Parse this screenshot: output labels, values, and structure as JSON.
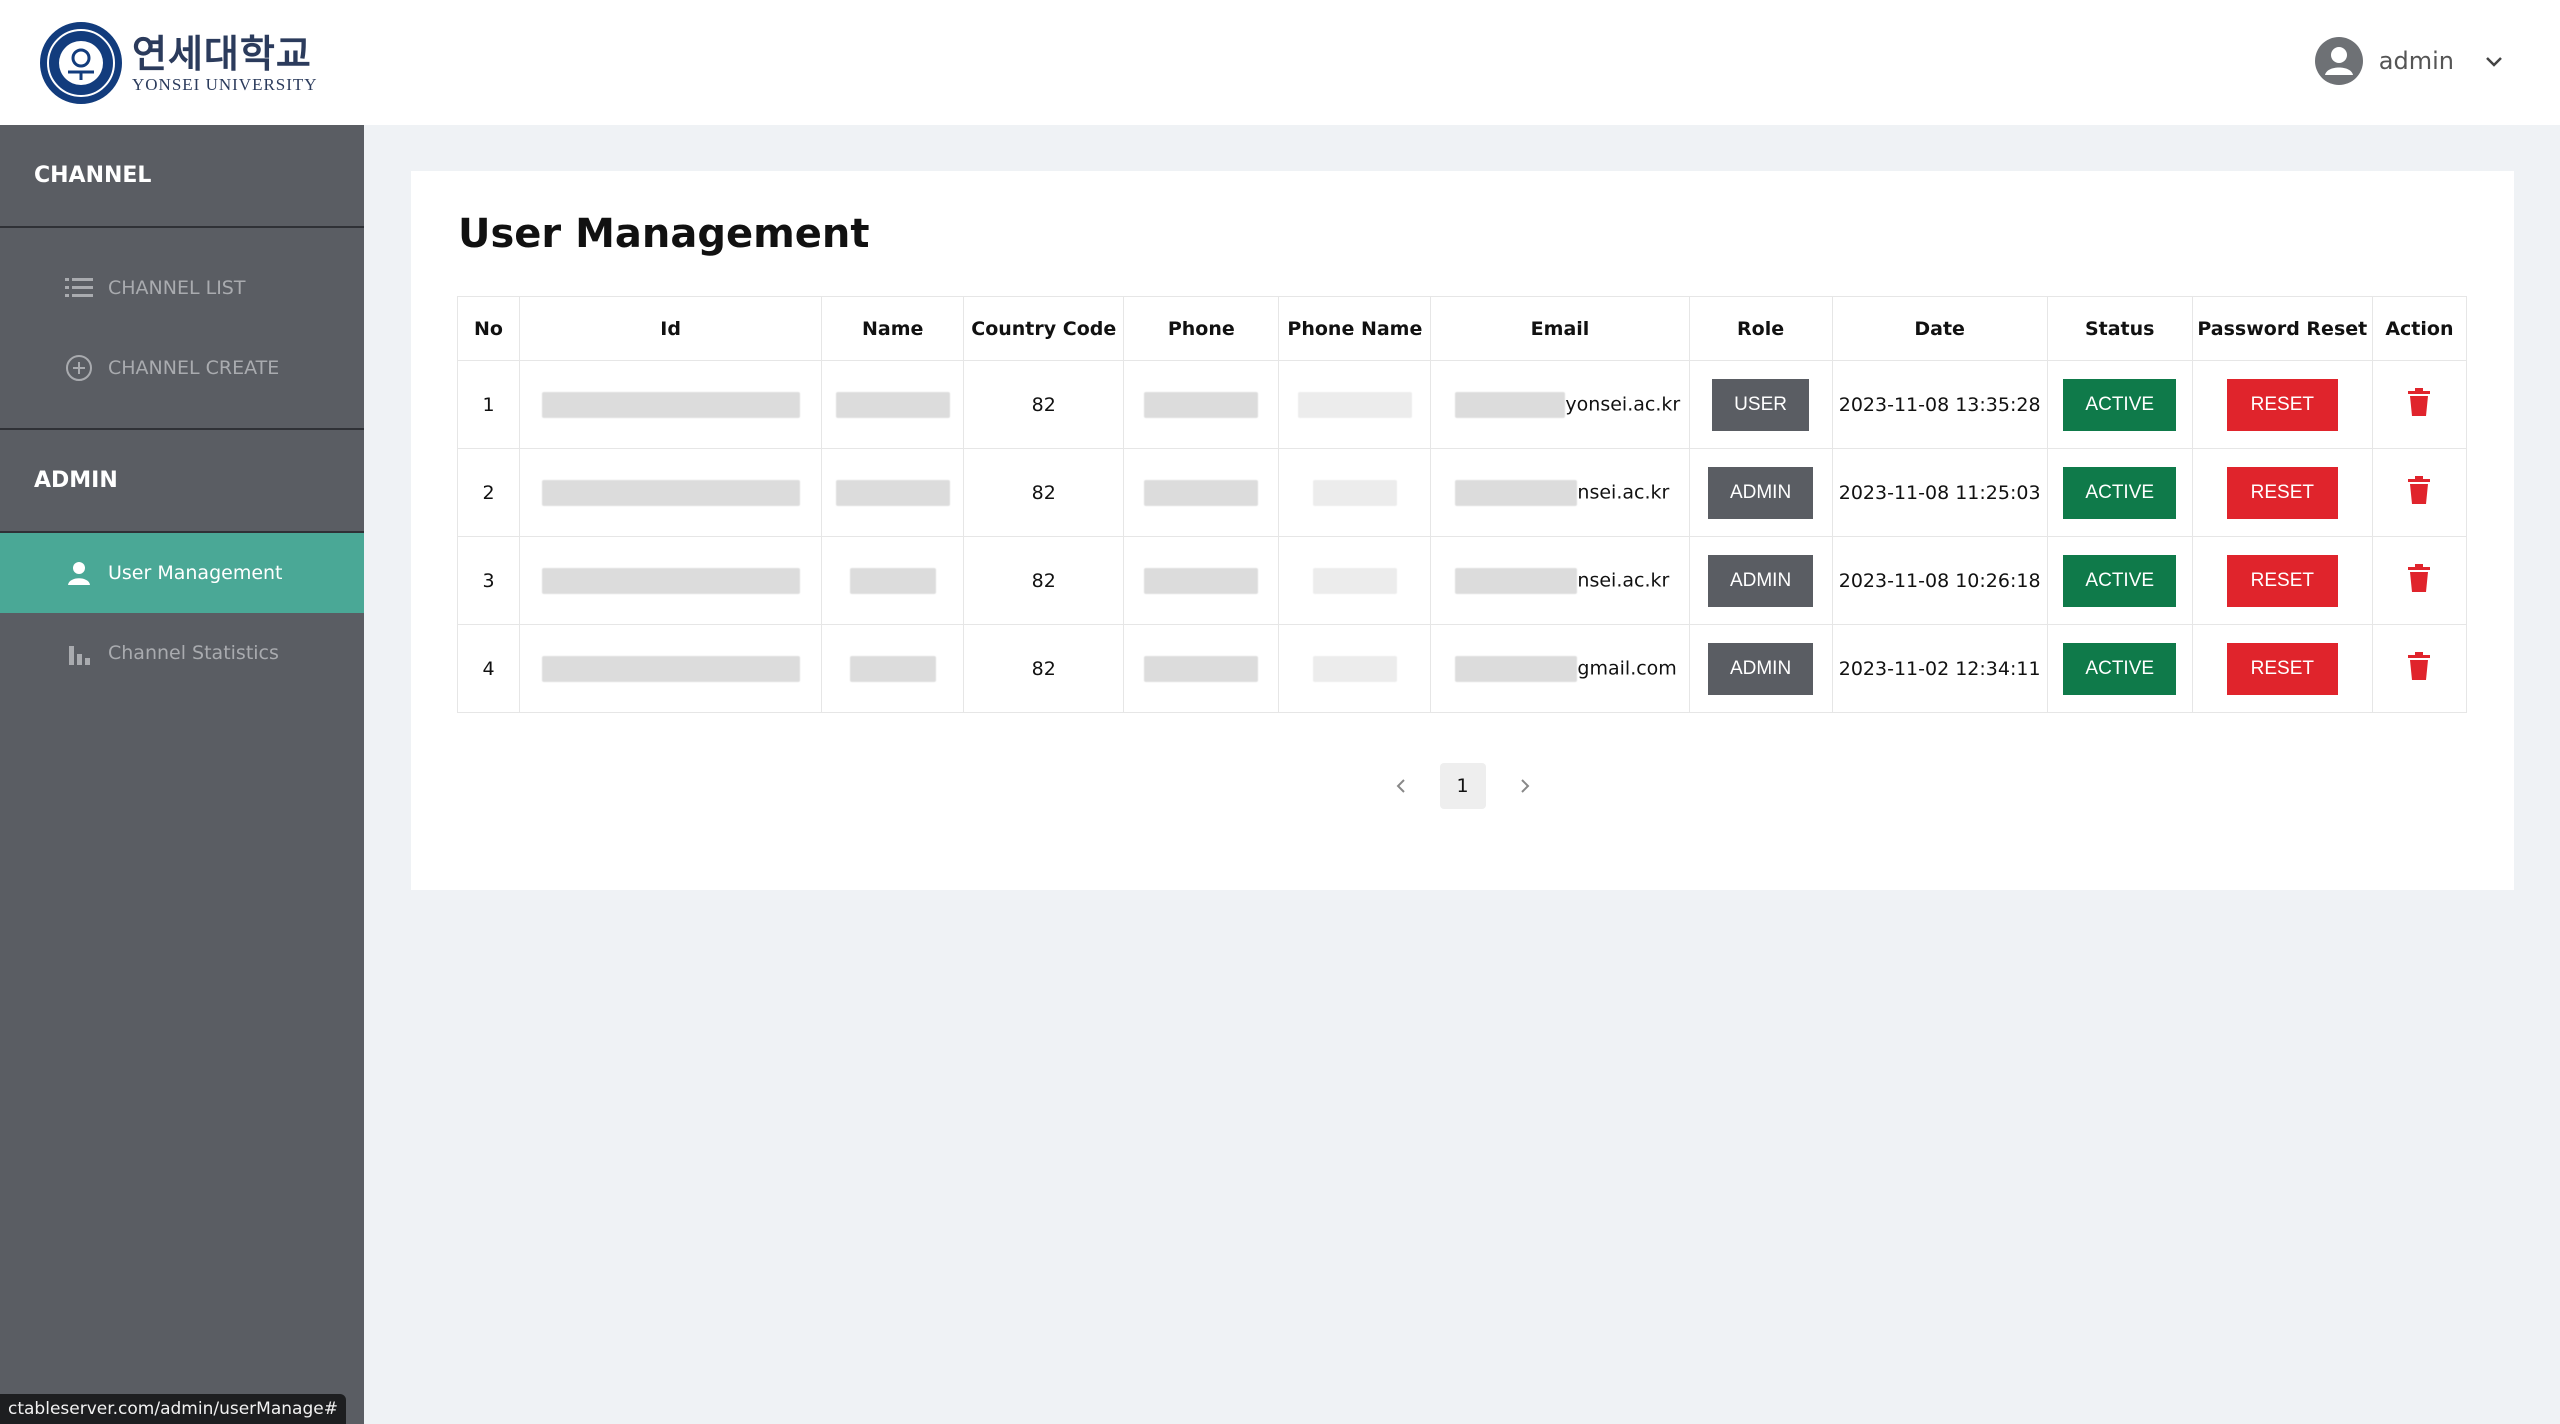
{
  "header": {
    "logo_korean": "연세대학교",
    "logo_english": "YONSEI UNIVERSITY",
    "user_name": "admin"
  },
  "sidebar": {
    "channel_title": "CHANNEL",
    "channel_items": [
      {
        "label": "CHANNEL LIST",
        "icon": "list-icon"
      },
      {
        "label": "CHANNEL CREATE",
        "icon": "plus-circle-icon"
      }
    ],
    "admin_title": "ADMIN",
    "admin_items": [
      {
        "label": "User Management",
        "icon": "user-icon",
        "active": true
      },
      {
        "label": "Channel Statistics",
        "icon": "bar-chart-icon",
        "active": false
      }
    ]
  },
  "main": {
    "title": "User Management",
    "columns": [
      "No",
      "Id",
      "Name",
      "Country Code",
      "Phone",
      "Phone Name",
      "Email",
      "Role",
      "Date",
      "Status",
      "Password Reset",
      "Action"
    ],
    "rows": [
      {
        "no": "1",
        "country_code": "82",
        "email_visible": "yonsei.ac.kr",
        "role": "USER",
        "date": "2023-11-08 13:35:28",
        "status": "ACTIVE",
        "reset": "RESET"
      },
      {
        "no": "2",
        "country_code": "82",
        "email_visible": "nsei.ac.kr",
        "role": "ADMIN",
        "date": "2023-11-08 11:25:03",
        "status": "ACTIVE",
        "reset": "RESET"
      },
      {
        "no": "3",
        "country_code": "82",
        "email_visible": "nsei.ac.kr",
        "role": "ADMIN",
        "date": "2023-11-08 10:26:18",
        "status": "ACTIVE",
        "reset": "RESET"
      },
      {
        "no": "4",
        "country_code": "82",
        "email_visible": "gmail.com",
        "role": "ADMIN",
        "date": "2023-11-02 12:34:11",
        "status": "ACTIVE",
        "reset": "RESET"
      }
    ],
    "pagination": {
      "current_page": "1"
    }
  },
  "status_bar_url": "ctableserver.com/admin/userManage#",
  "colors": {
    "sidebar_bg": "#5a5d63",
    "active_menu": "#4aa896",
    "status_active": "#0f7a4a",
    "reset_red": "#e0242c",
    "role_gray": "#5a5d63"
  }
}
